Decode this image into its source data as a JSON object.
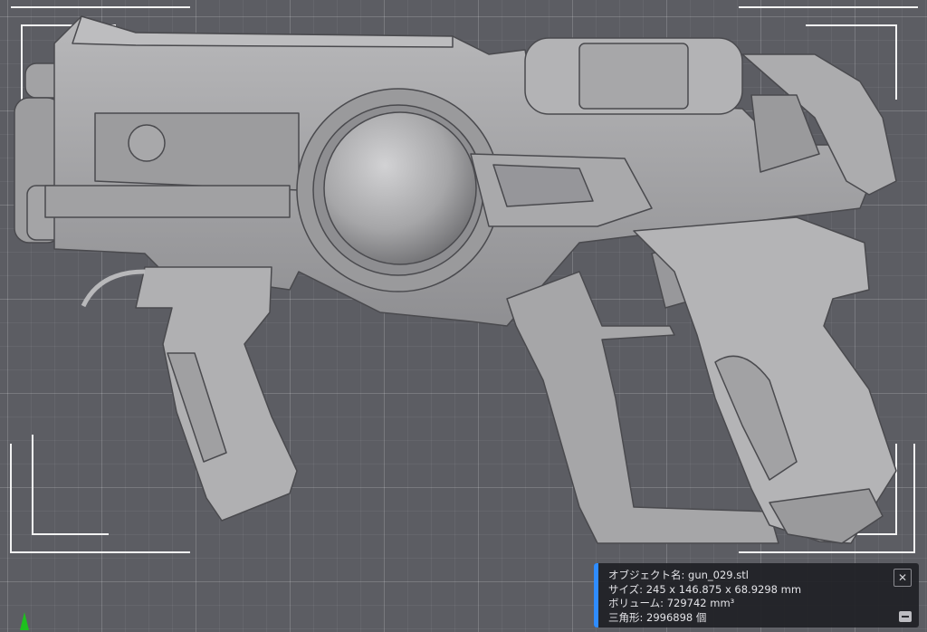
{
  "viewport": {
    "background_color": "#5c5d63",
    "model_color": "#a9a9ab"
  },
  "info_panel": {
    "accent_color": "#2f8cff",
    "object_label": "オブジェクト名:",
    "object_value": "gun_029.stl",
    "size_label": "サイズ:",
    "size_value": "245 x 146.875 x 68.9298 mm",
    "volume_label": "ボリューム:",
    "volume_value": "729742 mm³",
    "triangles_label": "三角形:",
    "triangles_value": "2996898 個",
    "close_icon": "close-icon",
    "minimize_icon": "minimize-icon"
  },
  "axis_marker": {
    "color": "#1ec01e",
    "icon": "axis-arrow-icon"
  }
}
